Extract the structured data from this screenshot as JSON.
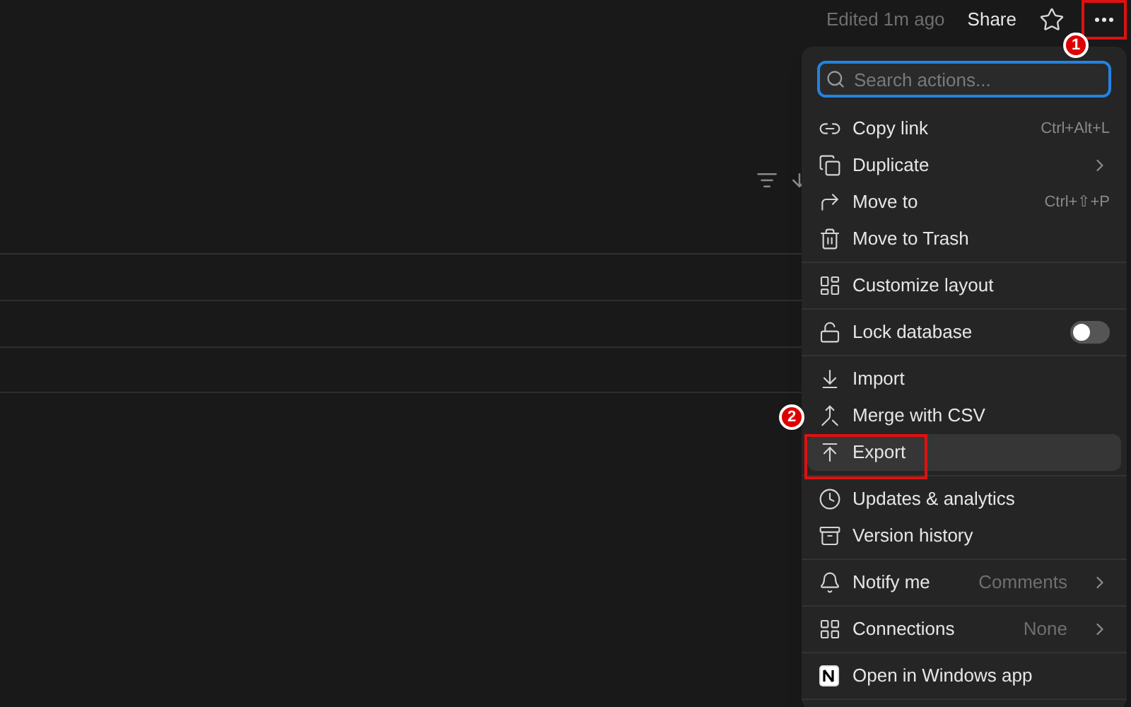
{
  "header": {
    "edited": "Edited 1m ago",
    "share": "Share",
    "starred": false
  },
  "menu": {
    "search": {
      "placeholder": "Search actions..."
    },
    "groups": [
      {
        "items": [
          {
            "kind": "action",
            "label": "Copy link",
            "shortcut": "Ctrl+Alt+L"
          },
          {
            "kind": "submenu",
            "label": "Duplicate"
          },
          {
            "kind": "action",
            "label": "Move to",
            "shortcut": "Ctrl+⇧+P"
          },
          {
            "kind": "action",
            "label": "Move to Trash"
          }
        ]
      },
      {
        "items": [
          {
            "kind": "action",
            "label": "Customize layout"
          }
        ]
      },
      {
        "items": [
          {
            "kind": "toggle",
            "label": "Lock database",
            "on": false
          }
        ]
      },
      {
        "items": [
          {
            "kind": "action",
            "label": "Import"
          },
          {
            "kind": "action",
            "label": "Merge with CSV"
          },
          {
            "kind": "action",
            "label": "Export",
            "selected": true
          }
        ]
      },
      {
        "items": [
          {
            "kind": "action",
            "label": "Updates & analytics"
          },
          {
            "kind": "action",
            "label": "Version history"
          }
        ]
      },
      {
        "items": [
          {
            "kind": "submenu",
            "label": "Notify me",
            "value": "Comments"
          }
        ]
      },
      {
        "items": [
          {
            "kind": "submenu",
            "label": "Connections",
            "value": "None"
          }
        ]
      },
      {
        "items": [
          {
            "kind": "action",
            "label": "Open in Windows app"
          }
        ]
      }
    ]
  },
  "annotations": [
    {
      "number": "1"
    },
    {
      "number": "2"
    }
  ]
}
